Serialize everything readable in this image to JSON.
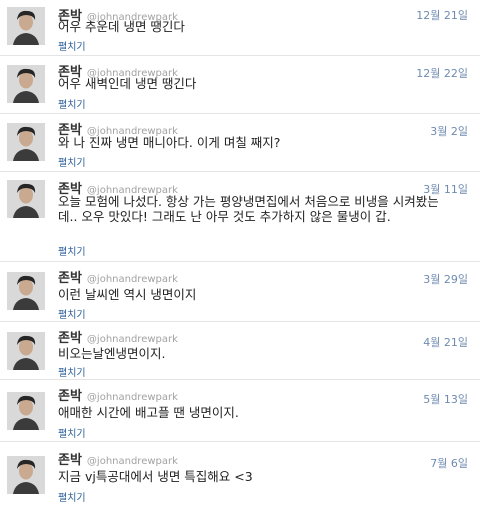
{
  "colors": {
    "date": "#6f8bb0",
    "expand": "#2b5f98",
    "handle": "#a2a2a2",
    "text": "#222222"
  },
  "tweets": [
    {
      "name": "존박",
      "handle": "@johnandrewpark",
      "date": "12월 21일",
      "text": "어우 추운데 냉면 땡긴다",
      "expand": "펼치기",
      "avatar_icon": "profile-photo"
    },
    {
      "name": "존박",
      "handle": "@johnandrewpark",
      "date": "12월 22일",
      "text": "어우 새벽인데 냉면 땡긴다",
      "expand": "펼치기",
      "avatar_icon": "profile-photo"
    },
    {
      "name": "존박",
      "handle": "@johnandrewpark",
      "date": "3월 2일",
      "text": "와 나 진짜 냉면 매니아다. 이게 며칠 째지?",
      "expand": "펼치기",
      "avatar_icon": "profile-photo"
    },
    {
      "name": "존박",
      "handle": "@johnandrewpark",
      "date": "3월 11일",
      "text": "오늘 모험에 나섰다. 항상 가는 평양냉면집에서 처음으로 비냉을 시켜봤는데.. 오우 맛있다! 그래도 난 아무 것도 추가하지 않은 물냉이 갑.",
      "expand": "펼치기",
      "avatar_icon": "profile-photo"
    },
    {
      "name": "존박",
      "handle": "@johnandrewpark",
      "date": "3월 29일",
      "text": "이런 날씨엔 역시 냉면이지",
      "expand": "펼치기",
      "avatar_icon": "profile-photo"
    },
    {
      "name": "존박",
      "handle": "@johnandrewpark",
      "date": "4월 21일",
      "text": "비오는날엔냉면이지.",
      "expand": "펼치기",
      "avatar_icon": "profile-photo"
    },
    {
      "name": "존박",
      "handle": "@johnandrewpark",
      "date": "5월 13일",
      "text": "애매한 시간에 배고플 땐 냉면이지.",
      "expand": "펼치기",
      "avatar_icon": "profile-photo"
    },
    {
      "name": "존박",
      "handle": "@johnandrewpark",
      "date": "7월 6일",
      "text": "지금 vj특공대에서 냉면 특집해요 <3",
      "expand": "펼치기",
      "avatar_icon": "profile-photo"
    }
  ]
}
